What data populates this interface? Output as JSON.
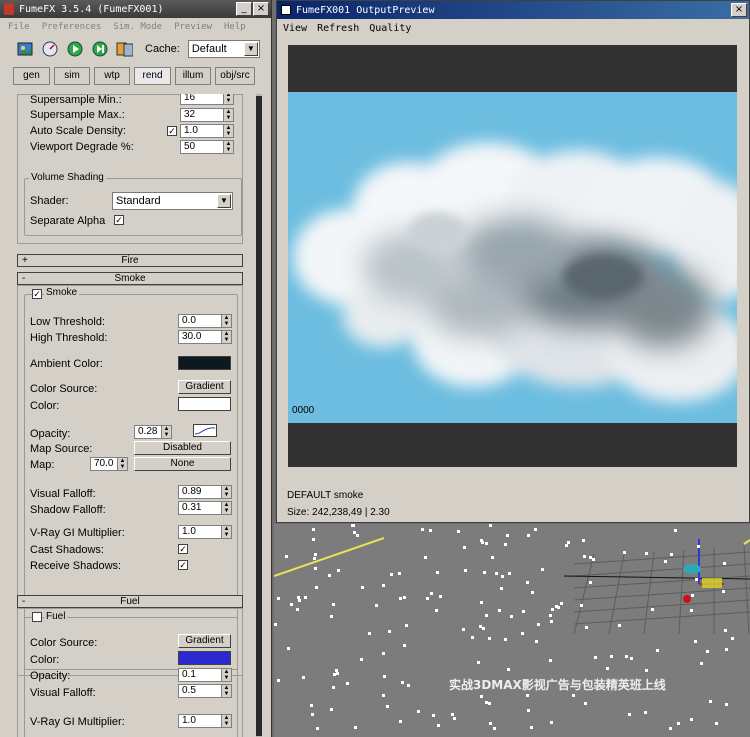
{
  "fx_window": {
    "title": "FumeFX 3.5.4 (FumeFX001)",
    "menu": [
      "File",
      "Preferences",
      "Sim. Mode",
      "Preview",
      "Help"
    ],
    "cache_label": "Cache:",
    "cache_value": "Default",
    "tabs": [
      "gen",
      "sim",
      "wtp",
      "rend",
      "illum",
      "obj/src"
    ],
    "active_tab": "rend"
  },
  "render_settings": {
    "supersample_min_label": "Supersample Min.:",
    "supersample_min_value": "16",
    "supersample_max_label": "Supersample Max.:",
    "supersample_max_value": "32",
    "auto_scale_label": "Auto Scale Density:",
    "auto_scale_value": "1.0",
    "viewport_degrade_label": "Viewport Degrade %:",
    "viewport_degrade_value": "50"
  },
  "volume_shading": {
    "group_label": "Volume Shading",
    "shader_label": "Shader:",
    "shader_value": "Standard",
    "separate_alpha_label": "Separate Alpha"
  },
  "fire": {
    "title": "Fire"
  },
  "smoke": {
    "title": "Smoke",
    "enable_label": "Smoke",
    "low_threshold_label": "Low Threshold:",
    "low_threshold_value": "0.0",
    "high_threshold_label": "High Threshold:",
    "high_threshold_value": "30.0",
    "ambient_color_label": "Ambient Color:",
    "ambient_color": "#0c1a1f",
    "color_source_label": "Color Source:",
    "color_source_value": "Gradient",
    "color_label": "Color:",
    "color": "#ffffff",
    "opacity_label": "Opacity:",
    "opacity_value": "0.28",
    "map_source_label": "Map Source:",
    "map_source_value": "Disabled",
    "map_label": "Map:",
    "map_amount": "70.0",
    "map_value": "None",
    "visual_falloff_label": "Visual Falloff:",
    "visual_falloff_value": "0.89",
    "shadow_falloff_label": "Shadow Falloff:",
    "shadow_falloff_value": "0.31",
    "vray_gi_label": "V-Ray GI Multiplier:",
    "vray_gi_value": "1.0",
    "cast_shadows_label": "Cast Shadows:",
    "receive_shadows_label": "Receive Shadows:"
  },
  "fuel": {
    "title": "Fuel",
    "enable_label": "Fuel",
    "color_source_label": "Color Source:",
    "color_source_value": "Gradient",
    "color_label": "Color:",
    "color": "#2a2ad0",
    "opacity_label": "Opacity:",
    "opacity_value": "0.1",
    "visual_falloff_label": "Visual Falloff:",
    "visual_falloff_value": "0.5",
    "vray_gi_label": "V-Ray GI Multiplier:",
    "vray_gi_value": "1.0"
  },
  "preview_window": {
    "title": "FumeFX001 OutputPreview",
    "menu": [
      "View",
      "Refresh",
      "Quality"
    ],
    "frame_number": "0000",
    "status_name": "DEFAULT smoke",
    "status_size": "Size: 242,238,49 | 2.30",
    "sky_color": "#6cbde0"
  },
  "viewport": {
    "watermark": "实战3DMAX影视广告与包装精英班上线"
  }
}
